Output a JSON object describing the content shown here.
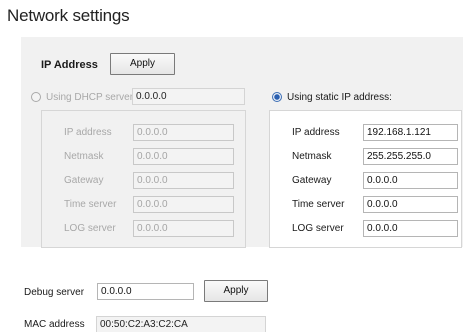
{
  "title": "Network settings",
  "ip_section": {
    "label": "IP Address",
    "apply_label": "Apply"
  },
  "dhcp": {
    "label": "Using DHCP server:",
    "server_value": "0.0.0.0",
    "selected": false,
    "rows": [
      {
        "label": "IP address",
        "value": "0.0.0.0"
      },
      {
        "label": "Netmask",
        "value": "0.0.0.0"
      },
      {
        "label": "Gateway",
        "value": "0.0.0.0"
      },
      {
        "label": "Time server",
        "value": "0.0.0.0"
      },
      {
        "label": "LOG server",
        "value": "0.0.0.0"
      }
    ]
  },
  "static": {
    "label": "Using static IP address:",
    "selected": true,
    "rows": [
      {
        "label": "IP address",
        "value": "192.168.1.121"
      },
      {
        "label": "Netmask",
        "value": "255.255.255.0"
      },
      {
        "label": "Gateway",
        "value": "0.0.0.0"
      },
      {
        "label": "Time server",
        "value": "0.0.0.0"
      },
      {
        "label": "LOG server",
        "value": "0.0.0.0"
      }
    ]
  },
  "debug": {
    "label": "Debug server",
    "value": "0.0.0.0",
    "apply_label": "Apply"
  },
  "mac": {
    "label": "MAC address",
    "value": "00:50:C2:A3:C2:CA"
  }
}
